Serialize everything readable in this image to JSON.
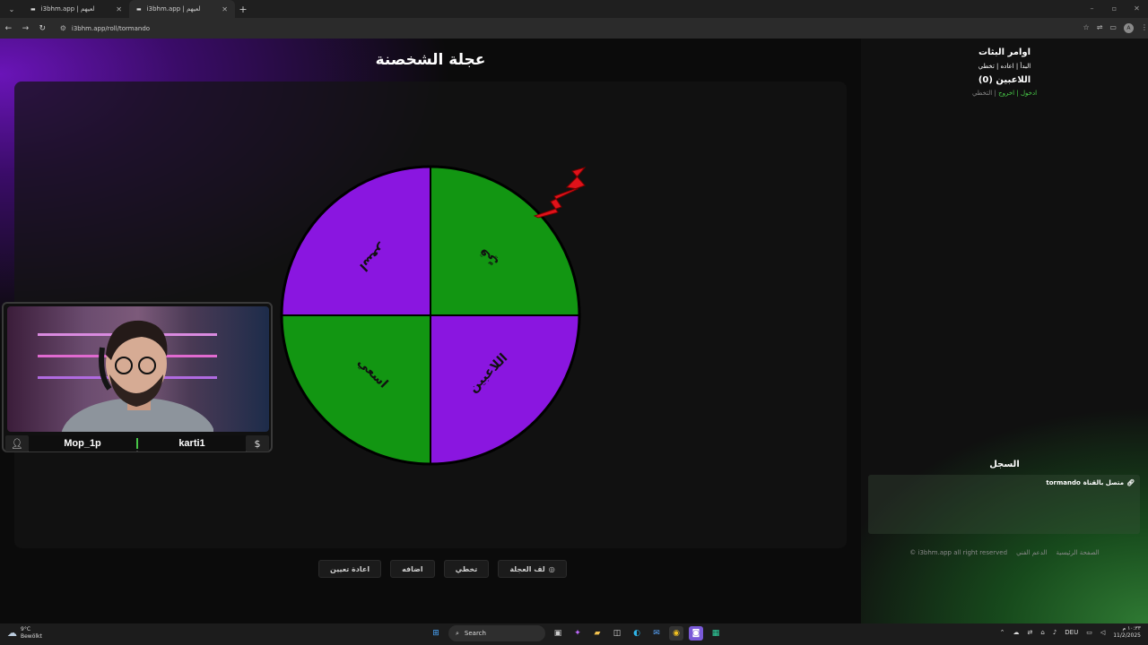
{
  "browser": {
    "tabs": [
      {
        "favicon": "▬",
        "title": "i3bhm.app | لعيهم"
      },
      {
        "favicon": "▬",
        "title": "i3bhm.app | لعيهم"
      }
    ],
    "url": "i3bhm.app/roll/tormando",
    "profile_initial": "A"
  },
  "page": {
    "title": "عجلة الشخصنة"
  },
  "wheel": {
    "segments": [
      {
        "label": "قيّ",
        "color": "#129612"
      },
      {
        "label": "اللاعبين",
        "color": "#8a16e0"
      },
      {
        "label": "اسعي",
        "color": "#129612"
      },
      {
        "label": "اسعر",
        "color": "#8a16e0"
      }
    ],
    "pointer_color": "#e0121a"
  },
  "actions": {
    "spin": "لف العجلة",
    "skip": "تخطي",
    "add": "اضافه",
    "reset": "اعادة تعيين"
  },
  "sidebar": {
    "commands_title": "اوامر البثات",
    "commands_line": "البدأ | اعاده | تخطي",
    "players_title": "اللاعبين (0)",
    "join": "ادخول",
    "leave": "اخروج",
    "skip": "التخطي",
    "log_title": "السجل",
    "log_entry_channel": "tormando",
    "log_entry_text": "متصل بالقناة",
    "footer_home": "الصفحة الرئيسية",
    "footer_support": "الدعم الفني",
    "footer_rights": "i3bhm.app all right reserved ©"
  },
  "webcam": {
    "left_name": "Mop_1p",
    "right_name": "karti1"
  },
  "taskbar": {
    "temp": "9°C",
    "weather": "Bewölkt",
    "search": "Search",
    "lang": "DEU",
    "time": "١٠:٣٣ م",
    "date": "11/2/2025"
  }
}
